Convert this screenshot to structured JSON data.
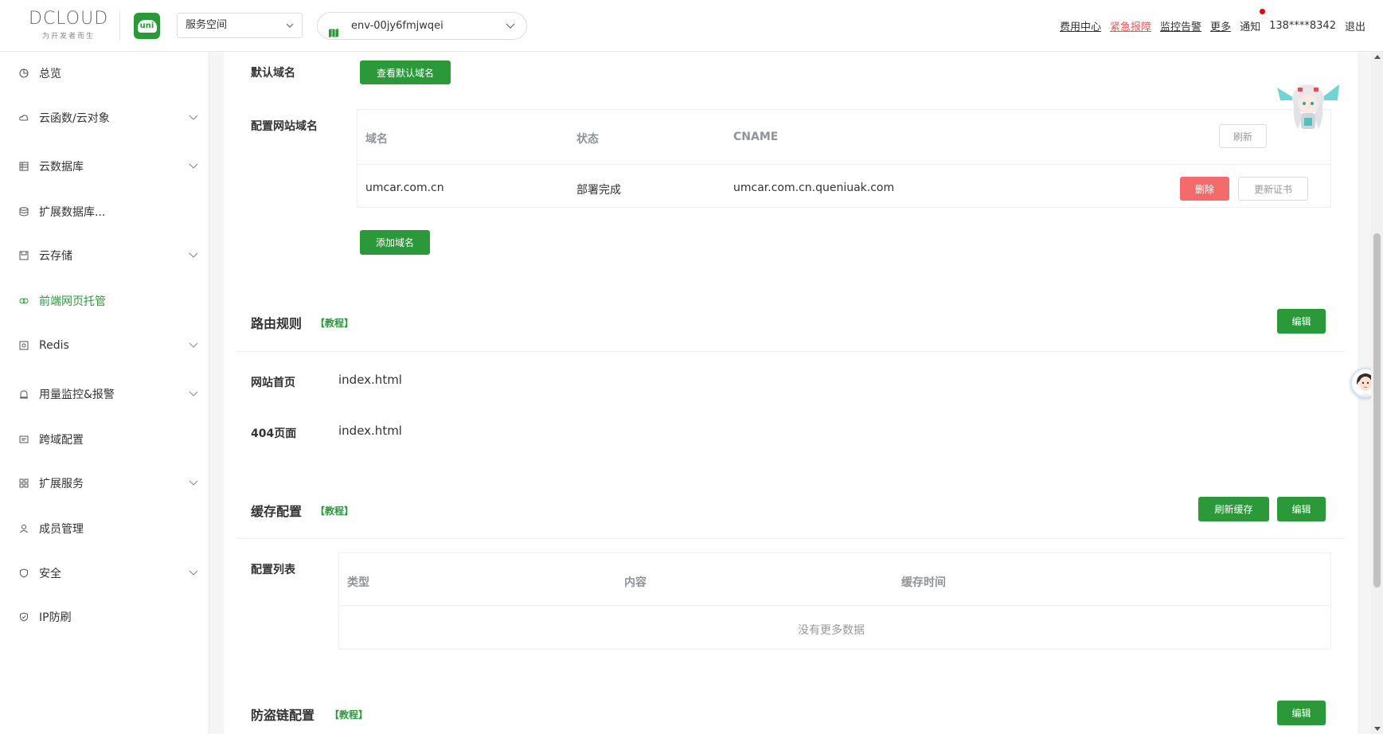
{
  "header": {
    "logo_text": "DCLOUD",
    "logo_tagline": "为开发者而生",
    "uni_logo_text": "uni",
    "space_select_value": "服务空间",
    "env_select_value": "env-00jy6fmjwqei",
    "nav": {
      "billing": "费用中心",
      "urgent": "紧急报障",
      "monitor": "监控告警",
      "more": "更多",
      "notify": "通知",
      "phone": "138****8342",
      "logout": "退出"
    }
  },
  "sidebar": {
    "items": [
      {
        "label": "总览",
        "icon": "pie-chart-icon"
      },
      {
        "label": "云函数/云对象",
        "icon": "cloud-icon"
      },
      {
        "label": "云数据库",
        "icon": "database-table-icon"
      },
      {
        "label": "扩展数据库...",
        "icon": "database-icon"
      },
      {
        "label": "云存储",
        "icon": "storage-icon"
      },
      {
        "label": "前端网页托管",
        "icon": "hosting-icon"
      },
      {
        "label": "Redis",
        "icon": "redis-icon"
      },
      {
        "label": "用量监控&报警",
        "icon": "alarm-icon"
      },
      {
        "label": "跨域配置",
        "icon": "cors-icon"
      },
      {
        "label": "扩展服务",
        "icon": "grid-icon"
      },
      {
        "label": "成员管理",
        "icon": "user-icon"
      },
      {
        "label": "安全",
        "icon": "shield-icon"
      },
      {
        "label": "IP防刷",
        "icon": "shield-check-icon"
      }
    ]
  },
  "domain_section": {
    "default_domain_label": "默认域名",
    "view_default_button": "查看默认域名",
    "config_domain_label": "配置网站域名",
    "table_headers": {
      "domain": "域名",
      "status": "状态",
      "cname": "CNAME"
    },
    "refresh_button": "刷新",
    "rows": [
      {
        "domain": "umcar.com.cn",
        "status": "部署完成",
        "cname": "umcar.com.cn.queniuak.com",
        "delete_label": "删除",
        "update_cert_label": "更新证书"
      }
    ],
    "add_domain_button": "添加域名"
  },
  "route_section": {
    "title": "路由规则",
    "tutorial": "【教程】",
    "edit_button": "编辑",
    "home_label": "网站首页",
    "home_value": "index.html",
    "notfound_label": "404页面",
    "notfound_value": "index.html"
  },
  "cache_section": {
    "title": "缓存配置",
    "tutorial": "【教程】",
    "refresh_cache_button": "刷新缓存",
    "edit_button": "编辑",
    "list_label": "配置列表",
    "headers": {
      "type": "类型",
      "content": "内容",
      "cache_time": "缓存时间"
    },
    "empty_text": "没有更多数据"
  },
  "hotlink_section": {
    "title": "防盗链配置",
    "tutorial": "【教程】",
    "edit_button": "编辑"
  },
  "colors": {
    "accent": "#2b9939",
    "danger": "#f36b6b",
    "urgent_link": "#e25c5c"
  }
}
